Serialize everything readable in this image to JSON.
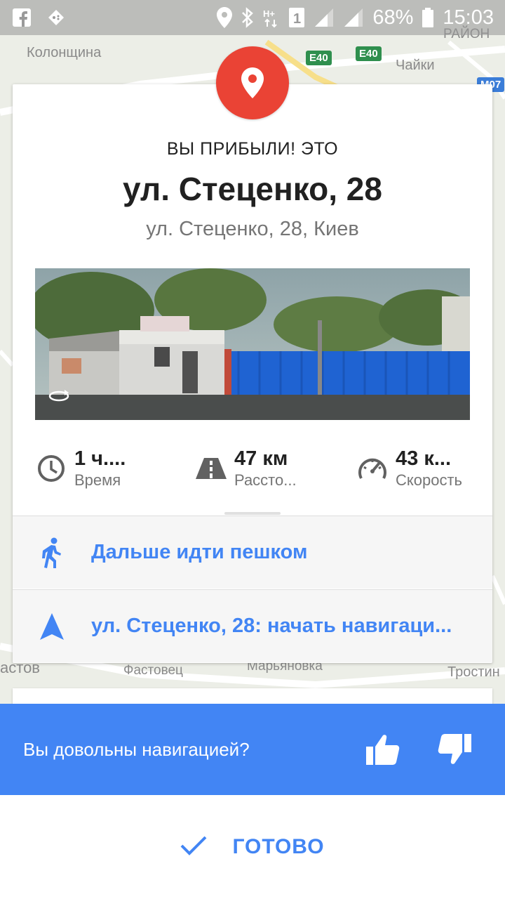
{
  "status_bar": {
    "battery_percent": "68%",
    "time": "15:03",
    "sim_badge": "1"
  },
  "map_labels": {
    "top_left": "Колонщина",
    "top_right_a": "Чайки",
    "top_right_b": "РАЙОН",
    "road_e40_a": "E40",
    "road_e40_b": "E40",
    "road_m07": "M07",
    "bottom_left": "астов",
    "bottom_mid_a": "Фастовец",
    "bottom_mid_b": "Марьяновка",
    "bottom_right": "Тростин"
  },
  "card": {
    "arrived_text": "ВЫ ПРИБЫЛИ! ЭТО",
    "destination_title": "ул. Стеценко, 28",
    "destination_address": "ул. Стеценко, 28, Киев",
    "stats": [
      {
        "value": "1 ч....",
        "label": "Время",
        "icon": "clock-icon"
      },
      {
        "value": "47 км",
        "label": "Рассто...",
        "icon": "road-icon"
      },
      {
        "value": "43 к...",
        "label": "Скорость",
        "icon": "speedometer-icon"
      }
    ],
    "actions": {
      "walk_label": "Дальше идти пешком",
      "navigate_label": "ул. Стеценко, 28: начать навигаци..."
    }
  },
  "feedback": {
    "question": "Вы довольны навигацией?"
  },
  "done": {
    "label": "ГОТОВО"
  },
  "colors": {
    "accent": "#4285f4",
    "pin": "#ea4335"
  }
}
